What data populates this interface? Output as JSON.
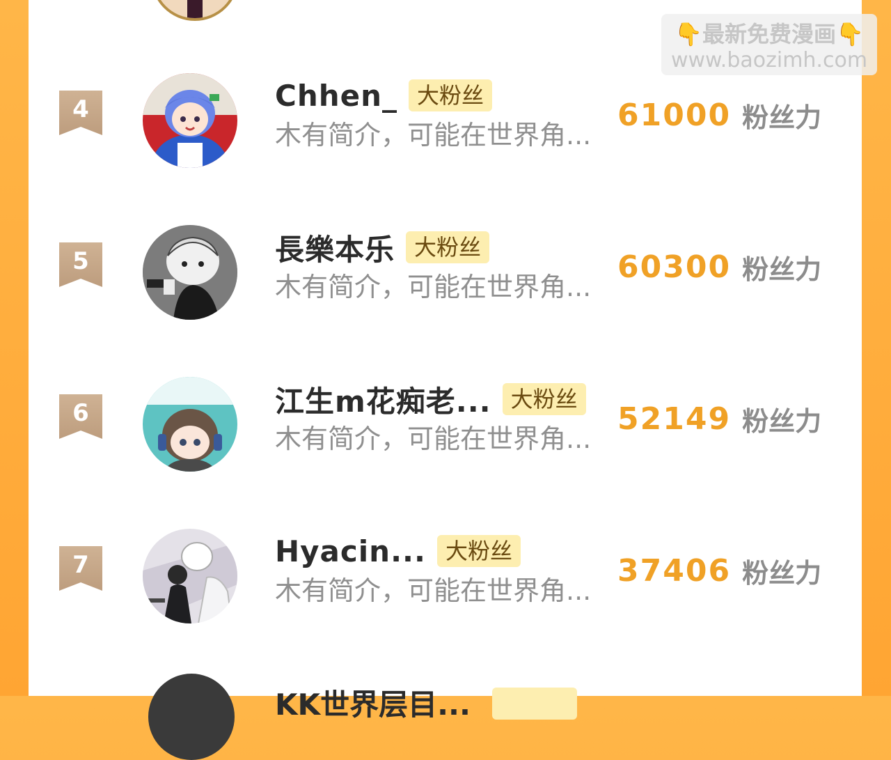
{
  "ranking": {
    "tag_label": "大粉丝",
    "score_unit": "粉丝力",
    "intro_text": "木有简介，可能在世界角...",
    "entries": [
      {
        "rank": "4",
        "name": "Chhen_",
        "score": "61000",
        "avatar": "anime-girl-blue-hair-avatar"
      },
      {
        "rank": "5",
        "name": "長樂本乐",
        "score": "60300",
        "avatar": "manga-character-with-gun-avatar"
      },
      {
        "rank": "6",
        "name": "江生m花痴老...",
        "score": "52149",
        "avatar": "chibi-character-headphones-avatar"
      },
      {
        "rank": "7",
        "name": "Hyacin...",
        "score": "37406",
        "avatar": "anime-characters-illustration-avatar"
      }
    ],
    "next_entry": {
      "name": "KK世界层目..."
    }
  },
  "watermark": {
    "line1_left_icon": "👇",
    "line1_text": "最新免费漫画",
    "line1_right_icon": "👇",
    "line2_text": "www.baozimh.com"
  },
  "colors": {
    "background_gradient_top": "#ffb648",
    "panel": "#ffffff",
    "score": "#f0a126",
    "tag_bg": "#fdeeb0",
    "rank_badge": "#c7a787"
  }
}
